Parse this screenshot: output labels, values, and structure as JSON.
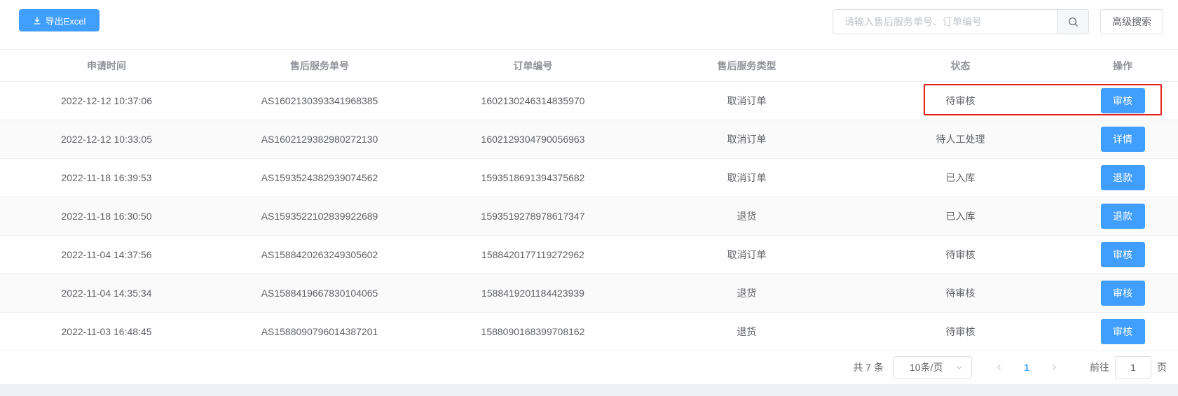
{
  "toolbar": {
    "export_label": "导出Excel",
    "search_placeholder": "请输入售后服务单号、订单编号",
    "search_value": "",
    "advanced_search_label": "高级搜索"
  },
  "table": {
    "headers": [
      "申请时间",
      "售后服务单号",
      "订单编号",
      "售后服务类型",
      "状态",
      "操作"
    ],
    "rows": [
      {
        "time": "2022-12-12 10:37:06",
        "service_no": "AS1602130393341968385",
        "order_no": "1602130246314835970",
        "type": "取消订单",
        "status": "待审核",
        "action": "审核"
      },
      {
        "time": "2022-12-12 10:33:05",
        "service_no": "AS1602129382980272130",
        "order_no": "1602129304790056963",
        "type": "取消订单",
        "status": "待人工处理",
        "action": "详情"
      },
      {
        "time": "2022-11-18 16:39:53",
        "service_no": "AS1593524382939074562",
        "order_no": "1593518691394375682",
        "type": "取消订单",
        "status": "已入库",
        "action": "退款"
      },
      {
        "time": "2022-11-18 16:30:50",
        "service_no": "AS1593522102839922689",
        "order_no": "1593519278978617347",
        "type": "退货",
        "status": "已入库",
        "action": "退款"
      },
      {
        "time": "2022-11-04 14:37:56",
        "service_no": "AS1588420263249305602",
        "order_no": "1588420177119272962",
        "type": "取消订单",
        "status": "待审核",
        "action": "审核"
      },
      {
        "time": "2022-11-04 14:35:34",
        "service_no": "AS1588419667830104065",
        "order_no": "1588419201184423939",
        "type": "退货",
        "status": "待审核",
        "action": "审核"
      },
      {
        "time": "2022-11-03 16:48:45",
        "service_no": "AS1588090796014387201",
        "order_no": "1588090168399708162",
        "type": "退货",
        "status": "待审核",
        "action": "审核"
      }
    ]
  },
  "pagination": {
    "total_text": "共 7 条",
    "page_size": "10条/页",
    "current_page": "1",
    "goto_label": "前往",
    "goto_value": "1",
    "page_unit": "页"
  },
  "colors": {
    "primary": "#409eff",
    "highlight_border": "#e4211d",
    "header_text": "#909399",
    "body_text": "#606266"
  },
  "icons": [
    "download-icon",
    "search-icon",
    "chevron-down-icon",
    "chevron-left-icon",
    "chevron-right-icon"
  ]
}
